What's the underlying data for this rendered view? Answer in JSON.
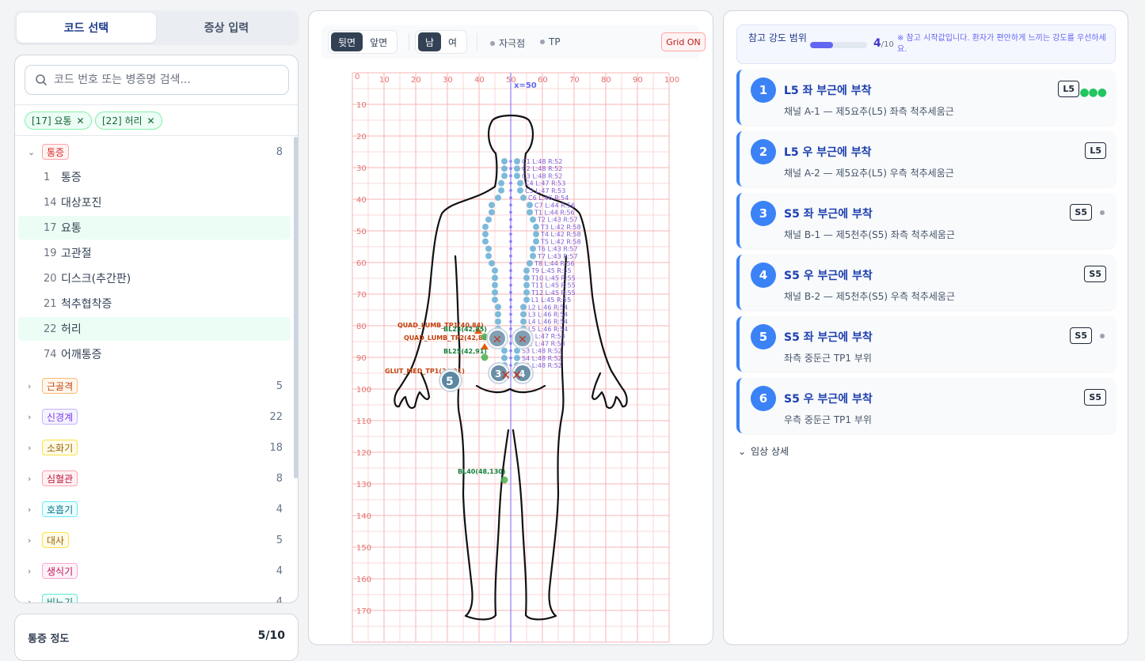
{
  "tabs": {
    "code_select": "코드 선택",
    "symptom_input": "증상 입력"
  },
  "search": {
    "placeholder": "코드 번호 또는 병증명 검색..."
  },
  "chips": [
    {
      "label": "[17] 요통"
    },
    {
      "label": "[22] 허리"
    }
  ],
  "tree": {
    "open_category": {
      "name": "통증",
      "count": "8",
      "color": "#dc2626"
    },
    "items": [
      {
        "num": "1",
        "name": "통증"
      },
      {
        "num": "14",
        "name": "대상포진"
      },
      {
        "num": "17",
        "name": "요통"
      },
      {
        "num": "19",
        "name": "고관절"
      },
      {
        "num": "20",
        "name": "디스크(추간판)"
      },
      {
        "num": "21",
        "name": "척추협착증"
      },
      {
        "num": "22",
        "name": "허리"
      },
      {
        "num": "74",
        "name": "어깨통증"
      }
    ],
    "categories": [
      {
        "name": "근골격",
        "count": "5"
      },
      {
        "name": "신경계",
        "count": "22"
      },
      {
        "name": "소화기",
        "count": "18"
      },
      {
        "name": "심혈관",
        "count": "8"
      },
      {
        "name": "호흡기",
        "count": "4"
      },
      {
        "name": "대사",
        "count": "5"
      },
      {
        "name": "생식기",
        "count": "4"
      },
      {
        "name": "비뇨기",
        "count": "4"
      }
    ]
  },
  "pain": {
    "label": "통증 정도",
    "value": "5/10"
  },
  "viewer": {
    "back": "뒷면",
    "front": "앞면",
    "male": "남",
    "female": "여",
    "legend_acupoint": "자극점",
    "legend_tp": "TP",
    "grid_button": "Grid ON",
    "x_ticks": [
      "0",
      "10",
      "20",
      "30",
      "40",
      "50",
      "60",
      "70",
      "80",
      "90",
      "100"
    ],
    "y_ticks": [
      "10",
      "20",
      "30",
      "40",
      "50",
      "60",
      "70",
      "80",
      "90",
      "100",
      "110",
      "120",
      "130",
      "140",
      "150",
      "160",
      "170"
    ],
    "origin_label": "0",
    "midline_label": "x=50",
    "spine_labels": [
      "C1 L:48 R:52",
      "C2 L:48 R:52",
      "C3 L:48 R:52",
      "C4 L:47 R:53",
      "C5 L:47 R:53",
      "C6 L:46 R:54",
      "C7 L:44 R:56",
      "T1 L:44 R:56",
      "T2 L:43 R:57",
      "T3 L:42 R:58",
      "T4 L:42 R:58",
      "T5 L:42 R:58",
      "T6 L:43 R:57",
      "T7 L:43 R:57",
      "T8 L:44 R:56",
      "T9 L:45 R:55",
      "T10 L:45 R:55",
      "T11 L:45 R:55",
      "T12 L:45 R:55",
      "L1 L:45 R:55",
      "L2 L:46 R:54",
      "L3 L:46 R:54",
      "L4 L:46 R:54",
      "L5 L:46 R:54",
      "S1 L:47 R:53",
      "S2 L:47 R:53",
      "S3 L:48 R:52",
      "S4 L:48 R:52",
      "S5 L:48 R:52"
    ],
    "tp_labels": {
      "quad1": "QUAD_LUMB_TP1(40,84)",
      "quad2": "QUAD_LUMB_TP2(42,88)",
      "glut": "GLUT_MED_TP1(34,91)",
      "bl23": "BL23(42,85)",
      "bl25": "BL25(42,91)",
      "bl40": "BL40(48,130)"
    },
    "markers": [
      "5",
      "3",
      "4"
    ]
  },
  "ref": {
    "label": "참고 강도 범위",
    "value": "4",
    "max": "/10",
    "level": 0.4,
    "note": "※ 참고 시작값입니다. 환자가 편안하게 느끼는 강도를 우선하세요."
  },
  "electrodes": [
    {
      "num": "1",
      "title": "L5 좌 부근에 부착",
      "desc": "채널 A-1 — 제5요추(L5) 좌측 척추세움근",
      "badge": "L5",
      "extra": "more"
    },
    {
      "num": "2",
      "title": "L5 우 부근에 부착",
      "desc": "채널 A-2 — 제5요추(L5) 우측 척추세움근",
      "badge": "L5",
      "extra": ""
    },
    {
      "num": "3",
      "title": "S5 좌 부근에 부착",
      "desc": "채널 B-1 — 제5천추(S5) 좌측 척추세움근",
      "badge": "S5",
      "extra": "dot"
    },
    {
      "num": "4",
      "title": "S5 우 부근에 부착",
      "desc": "채널 B-2 — 제5천추(S5) 우측 척추세움근",
      "badge": "S5",
      "extra": ""
    },
    {
      "num": "5",
      "title": "S5 좌 부근에 부착",
      "desc": "좌측 중둔근 TP1 부위",
      "badge": "S5",
      "extra": "dot"
    },
    {
      "num": "6",
      "title": "S5 우 부근에 부착",
      "desc": "우측 중둔근 TP1 부위",
      "badge": "S5",
      "extra": ""
    }
  ],
  "detail": "임상 상세",
  "more_glyph": "●●●"
}
